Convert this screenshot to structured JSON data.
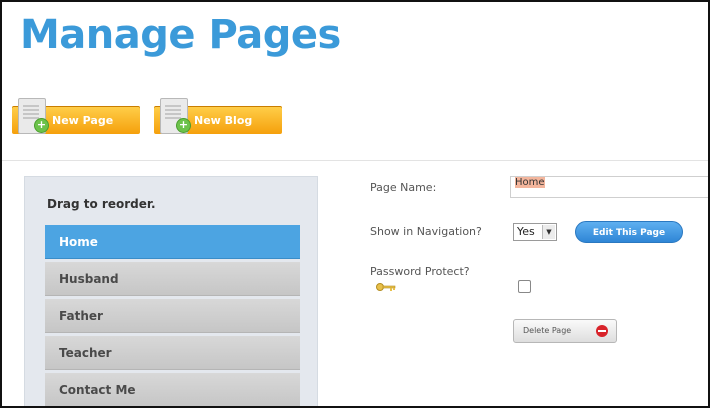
{
  "header": {
    "title": "Manage Pages"
  },
  "toolbar": {
    "new_page_label": "New Page",
    "new_blog_label": "New Blog"
  },
  "sidebar": {
    "instruction": "Drag to reorder.",
    "items": [
      {
        "label": "Home",
        "active": true
      },
      {
        "label": "Husband",
        "active": false
      },
      {
        "label": "Father",
        "active": false
      },
      {
        "label": "Teacher",
        "active": false
      },
      {
        "label": "Contact Me",
        "active": false
      }
    ]
  },
  "form": {
    "page_name_label": "Page Name:",
    "page_name_value": "Home",
    "show_in_nav_label": "Show in Navigation?",
    "show_in_nav_value": "Yes",
    "edit_button_label": "Edit This Page",
    "password_protect_label": "Password Protect?",
    "password_protect_checked": false,
    "delete_button_label": "Delete Page"
  },
  "colors": {
    "title": "#3b9ad9",
    "accent_orange": "#f5a00c",
    "active_nav": "#4ca4e2",
    "edit_button": "#2f86d6",
    "delete_icon": "#d8232a"
  }
}
